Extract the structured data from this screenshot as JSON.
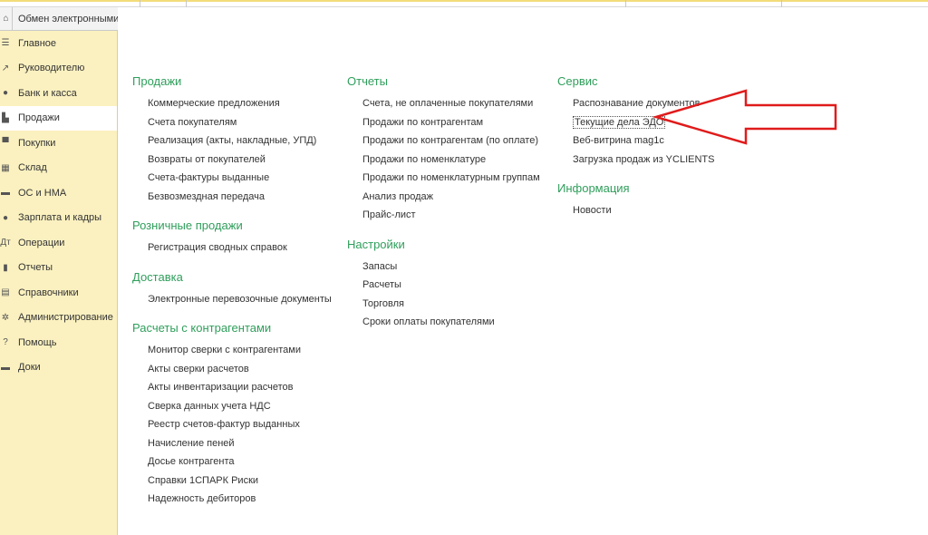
{
  "tab": {
    "title": "Обмен электронными д"
  },
  "colors": {
    "accent_green": "#2f9e5b",
    "sidebar_bg": "#fbf1c0",
    "arrow_red": "#e01b1b"
  },
  "sidebar": {
    "items": [
      {
        "label": "Главное",
        "icon": "menu-icon",
        "glyph": "☰"
      },
      {
        "label": "Руководителю",
        "icon": "trend-icon",
        "glyph": "↗"
      },
      {
        "label": "Банк и касса",
        "icon": "coin-icon",
        "glyph": "●"
      },
      {
        "label": "Продажи",
        "icon": "bag-icon",
        "glyph": "▙"
      },
      {
        "label": "Покупки",
        "icon": "cart-icon",
        "glyph": "▀"
      },
      {
        "label": "Склад",
        "icon": "warehouse-icon",
        "glyph": "▦"
      },
      {
        "label": "ОС и НМА",
        "icon": "assets-icon",
        "glyph": "▬"
      },
      {
        "label": "Зарплата и кадры",
        "icon": "person-icon",
        "glyph": "●"
      },
      {
        "label": "Операции",
        "icon": "operations-icon",
        "glyph": "Дт"
      },
      {
        "label": "Отчеты",
        "icon": "bar-chart-icon",
        "glyph": "▮"
      },
      {
        "label": "Справочники",
        "icon": "book-icon",
        "glyph": "▤"
      },
      {
        "label": "Администрирование",
        "icon": "gear-icon",
        "glyph": "✲"
      },
      {
        "label": "Помощь",
        "icon": "help-icon",
        "glyph": "?"
      },
      {
        "label": "Доки",
        "icon": "docs-icon",
        "glyph": "▬"
      }
    ],
    "active_index": 3
  },
  "columns": [
    {
      "sections": [
        {
          "title": "Продажи",
          "links": [
            "Коммерческие предложения",
            "Счета покупателям",
            "Реализация (акты, накладные, УПД)",
            "Возвраты от покупателей",
            "Счета-фактуры выданные",
            "Безвозмездная передача"
          ]
        },
        {
          "title": "Розничные продажи",
          "links": [
            "Регистрация сводных справок"
          ]
        },
        {
          "title": "Доставка",
          "links": [
            "Электронные перевозочные документы"
          ]
        },
        {
          "title": "Расчеты с контрагентами",
          "links": [
            "Монитор сверки с контрагентами",
            "Акты сверки расчетов",
            "Акты инвентаризации расчетов",
            "Сверка данных учета НДС",
            "Реестр счетов-фактур выданных",
            "Начисление пеней",
            "Досье контрагента",
            "Справки 1СПАРК Риски",
            "Надежность дебиторов"
          ]
        }
      ]
    },
    {
      "sections": [
        {
          "title": "Отчеты",
          "links": [
            "Счета, не оплаченные покупателями",
            "Продажи по контрагентам",
            "Продажи по контрагентам (по оплате)",
            "Продажи по номенклатуре",
            "Продажи по номенклатурным группам",
            "Анализ продаж",
            "Прайс-лист"
          ]
        },
        {
          "title": "Настройки",
          "links": [
            "Запасы",
            "Расчеты",
            "Торговля",
            "Сроки оплаты покупателями"
          ]
        }
      ]
    },
    {
      "sections": [
        {
          "title": "Сервис",
          "links": [
            "Распознавание документов",
            "Текущие дела ЭДО",
            "Веб-витрина mag1c",
            "Загрузка продаж из YCLIENTS"
          ]
        },
        {
          "title": "Информация",
          "links": [
            "Новости"
          ]
        }
      ]
    }
  ],
  "highlighted_link": "Текущие дела ЭДО"
}
